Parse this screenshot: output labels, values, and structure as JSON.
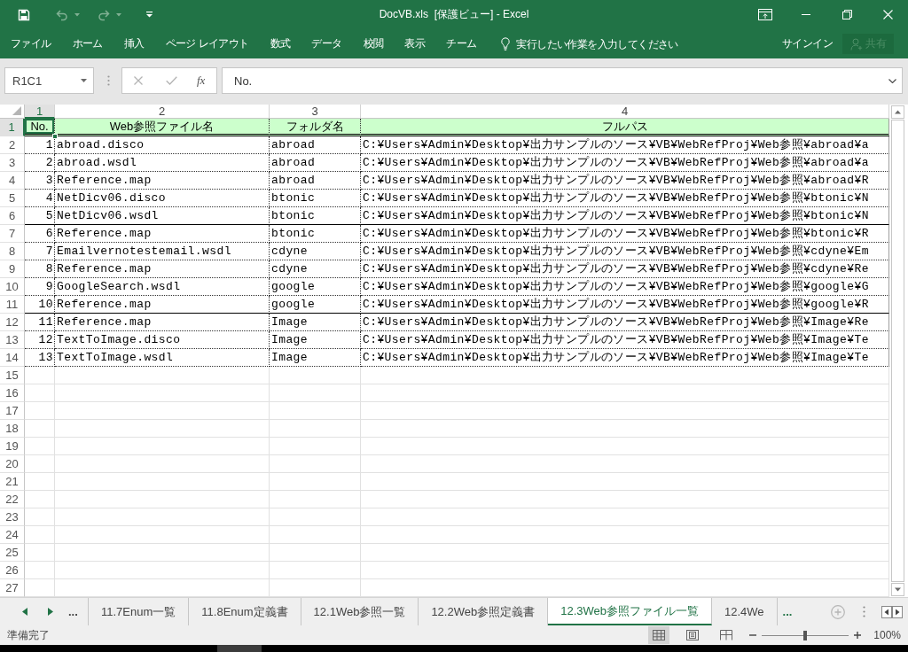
{
  "window": {
    "title": "DocVB.xls  [保護ビュー] - Excel"
  },
  "quick_access": [
    {
      "kind": "save",
      "disabled": false
    },
    {
      "kind": "undo",
      "disabled": true
    },
    {
      "kind": "redo",
      "disabled": true
    }
  ],
  "ribbon": {
    "tabs": [
      {
        "label": "ファイル",
        "selected": false
      },
      {
        "label": "ホーム",
        "selected": false
      },
      {
        "label": "挿入",
        "selected": false
      },
      {
        "label": "ページ レイアウト",
        "selected": false
      },
      {
        "label": "数式",
        "selected": false
      },
      {
        "label": "データ",
        "selected": false
      },
      {
        "label": "校閲",
        "selected": false
      },
      {
        "label": "表示",
        "selected": false
      },
      {
        "label": "チーム",
        "selected": false
      }
    ],
    "tell_me": {
      "placeholder": "実行したい作業を入力してください"
    },
    "sign_in": "サインイン",
    "share": {
      "label": "共有",
      "disabled": true
    }
  },
  "formula_bar": {
    "name_box": "R1C1",
    "cancel": {
      "disabled": true
    },
    "enter": {
      "disabled": true
    },
    "function_label": "fx",
    "value": "No."
  },
  "grid": {
    "columns": [
      {
        "label": "1",
        "selected": true
      },
      {
        "label": "2",
        "selected": false
      },
      {
        "label": "3",
        "selected": false
      },
      {
        "label": "4",
        "selected": false
      }
    ],
    "rows": [
      {
        "label": "1",
        "kind": "header",
        "selected": true,
        "cells": [
          "No.",
          "Web参照ファイル名",
          "フォルダ名",
          "フルパス"
        ]
      },
      {
        "label": "2",
        "kind": "data",
        "selected": false,
        "cells": [
          "1",
          "abroad.disco",
          "abroad",
          "C:¥Users¥Admin¥Desktop¥出力サンプルのソース¥VB¥WebRefProj¥Web参照¥abroad¥a"
        ]
      },
      {
        "label": "3",
        "kind": "data",
        "selected": false,
        "cells": [
          "2",
          "abroad.wsdl",
          "abroad",
          "C:¥Users¥Admin¥Desktop¥出力サンプルのソース¥VB¥WebRefProj¥Web参照¥abroad¥a"
        ]
      },
      {
        "label": "4",
        "kind": "data",
        "selected": false,
        "cells": [
          "3",
          "Reference.map",
          "abroad",
          "C:¥Users¥Admin¥Desktop¥出力サンプルのソース¥VB¥WebRefProj¥Web参照¥abroad¥R"
        ]
      },
      {
        "label": "5",
        "kind": "data",
        "selected": false,
        "cells": [
          "4",
          "NetDicv06.disco",
          "btonic",
          "C:¥Users¥Admin¥Desktop¥出力サンプルのソース¥VB¥WebRefProj¥Web参照¥btonic¥N"
        ]
      },
      {
        "label": "6",
        "kind": "data",
        "selected": false,
        "cells": [
          "5",
          "NetDicv06.wsdl",
          "btonic",
          "C:¥Users¥Admin¥Desktop¥出力サンプルのソース¥VB¥WebRefProj¥Web参照¥btonic¥N"
        ]
      },
      {
        "label": "7",
        "kind": "data",
        "selected": false,
        "cells": [
          "6",
          "Reference.map",
          "btonic",
          "C:¥Users¥Admin¥Desktop¥出力サンプルのソース¥VB¥WebRefProj¥Web参照¥btonic¥R"
        ]
      },
      {
        "label": "8",
        "kind": "data",
        "selected": false,
        "cells": [
          "7",
          "Emailvernotestemail.wsdl",
          "cdyne",
          "C:¥Users¥Admin¥Desktop¥出力サンプルのソース¥VB¥WebRefProj¥Web参照¥cdyne¥Em"
        ]
      },
      {
        "label": "9",
        "kind": "data",
        "selected": false,
        "cells": [
          "8",
          "Reference.map",
          "cdyne",
          "C:¥Users¥Admin¥Desktop¥出力サンプルのソース¥VB¥WebRefProj¥Web参照¥cdyne¥Re"
        ]
      },
      {
        "label": "10",
        "kind": "data",
        "selected": false,
        "cells": [
          "9",
          "GoogleSearch.wsdl",
          "google",
          "C:¥Users¥Admin¥Desktop¥出力サンプルのソース¥VB¥WebRefProj¥Web参照¥google¥G"
        ]
      },
      {
        "label": "11",
        "kind": "data",
        "selected": false,
        "cells": [
          "10",
          "Reference.map",
          "google",
          "C:¥Users¥Admin¥Desktop¥出力サンプルのソース¥VB¥WebRefProj¥Web参照¥google¥R"
        ]
      },
      {
        "label": "12",
        "kind": "data",
        "selected": false,
        "cells": [
          "11",
          "Reference.map",
          "Image",
          "C:¥Users¥Admin¥Desktop¥出力サンプルのソース¥VB¥WebRefProj¥Web参照¥Image¥Re"
        ]
      },
      {
        "label": "13",
        "kind": "data",
        "selected": false,
        "cells": [
          "12",
          "TextToImage.disco",
          "Image",
          "C:¥Users¥Admin¥Desktop¥出力サンプルのソース¥VB¥WebRefProj¥Web参照¥Image¥Te"
        ]
      },
      {
        "label": "14",
        "kind": "data",
        "selected": false,
        "cells": [
          "13",
          "TextToImage.wsdl",
          "Image",
          "C:¥Users¥Admin¥Desktop¥出力サンプルのソース¥VB¥WebRefProj¥Web参照¥Image¥Te"
        ]
      },
      {
        "label": "15",
        "kind": "empty",
        "selected": false
      },
      {
        "label": "16",
        "kind": "empty",
        "selected": false
      },
      {
        "label": "17",
        "kind": "empty",
        "selected": false
      },
      {
        "label": "18",
        "kind": "empty",
        "selected": false
      },
      {
        "label": "19",
        "kind": "empty",
        "selected": false
      },
      {
        "label": "20",
        "kind": "empty",
        "selected": false
      },
      {
        "label": "21",
        "kind": "empty",
        "selected": false
      },
      {
        "label": "22",
        "kind": "empty",
        "selected": false
      },
      {
        "label": "23",
        "kind": "empty",
        "selected": false
      },
      {
        "label": "24",
        "kind": "empty",
        "selected": false
      },
      {
        "label": "25",
        "kind": "empty",
        "selected": false
      },
      {
        "label": "26",
        "kind": "empty",
        "selected": false
      },
      {
        "label": "27",
        "kind": "empty",
        "selected": false
      }
    ]
  },
  "sheet_tabs": {
    "more_left": "...",
    "tabs": [
      {
        "label": "11.7Enum一覧",
        "selected": false
      },
      {
        "label": "11.8Enum定義書",
        "selected": false
      },
      {
        "label": "12.1Web参照一覧",
        "selected": false
      },
      {
        "label": "12.2Web参照定義書",
        "selected": false
      },
      {
        "label": "12.3Web参照ファイル一覧",
        "selected": true
      },
      {
        "label": "12.4We",
        "selected": false
      }
    ],
    "more_right": "..."
  },
  "status_bar": {
    "status": "準備完了",
    "views": [
      {
        "kind": "normal",
        "selected": true
      },
      {
        "kind": "page_layout",
        "selected": false
      },
      {
        "kind": "page_break",
        "selected": false
      }
    ],
    "zoom": {
      "level": 0.5,
      "reading": "100%"
    }
  }
}
